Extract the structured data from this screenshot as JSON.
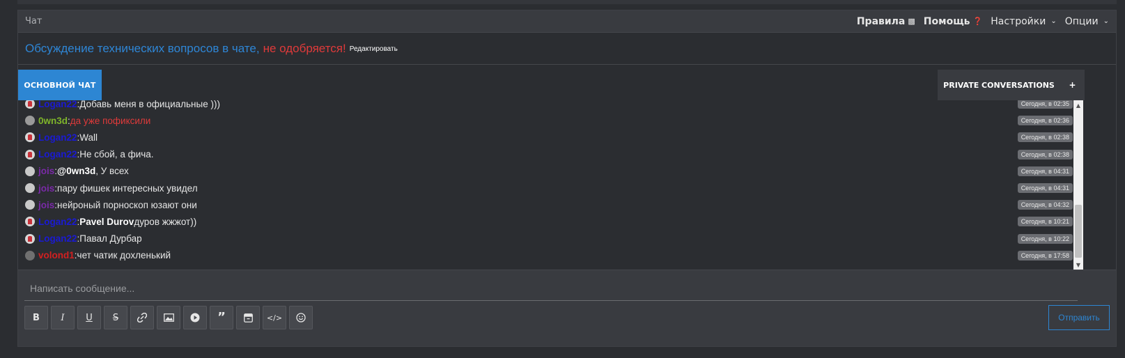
{
  "header": {
    "title": "Чат",
    "links": [
      {
        "label": "Правила",
        "icon": "book-icon"
      },
      {
        "label": "Помощь",
        "icon": "question-circle-icon"
      },
      {
        "label": "Настройки",
        "icon": "chevron-down-icon"
      },
      {
        "label": "Опции",
        "icon": "chevron-down-icon"
      }
    ]
  },
  "notice": {
    "text_blue": "Обсуждение технических вопросов в чате,",
    "text_red": "не одобряется!",
    "edit_label": "Редактировать"
  },
  "tabs": {
    "main": "ОСНОВНОЙ ЧАТ",
    "private": "PRIVATE CONVERSATIONS",
    "add": "+"
  },
  "messages": [
    {
      "user": "Logan22",
      "user_color": "#1a1ad4",
      "text": "Добавь меня в официальные )))",
      "time": "Сегодня, в 02:35"
    },
    {
      "user": "0wn3d",
      "user_color": "#7fb52a",
      "text": "да уже пофиксили",
      "text_color": "#e03a3a",
      "time": "Сегодня, в 02:36"
    },
    {
      "user": "Logan22",
      "user_color": "#1a1ad4",
      "text": "Wall",
      "time": "Сегодня, в 02:38"
    },
    {
      "user": "Logan22",
      "user_color": "#1a1ad4",
      "text": "Не сбой, а фича.",
      "time": "Сегодня, в 02:38"
    },
    {
      "user": "jois",
      "user_color": "#7a2aa8",
      "mention": "@0wn3d",
      "text": ", У всех",
      "time": "Сегодня, в 04:31"
    },
    {
      "user": "jois",
      "user_color": "#7a2aa8",
      "text": "пару фишек интересных увидел",
      "time": "Сегодня, в 04:31"
    },
    {
      "user": "jois",
      "user_color": "#7a2aa8",
      "text": "нейроный порноскоп юзают они",
      "time": "Сегодня, в 04:32"
    },
    {
      "user": "Logan22",
      "user_color": "#1a1ad4",
      "mention": "Pavel Durov",
      "text": " дуров жжжот))",
      "time": "Сегодня, в 10:21"
    },
    {
      "user": "Logan22",
      "user_color": "#1a1ad4",
      "text": "Павал Дурбар",
      "time": "Сегодня, в 10:22"
    },
    {
      "user": "volond1",
      "user_color": "#d42020",
      "text": "чет чатик дохленький",
      "time": "Сегодня, в 17:58"
    }
  ],
  "composer": {
    "placeholder": "Написать сообщение...",
    "send_label": "Отправить",
    "toolbar": [
      "B",
      "I",
      "U",
      "S"
    ]
  }
}
